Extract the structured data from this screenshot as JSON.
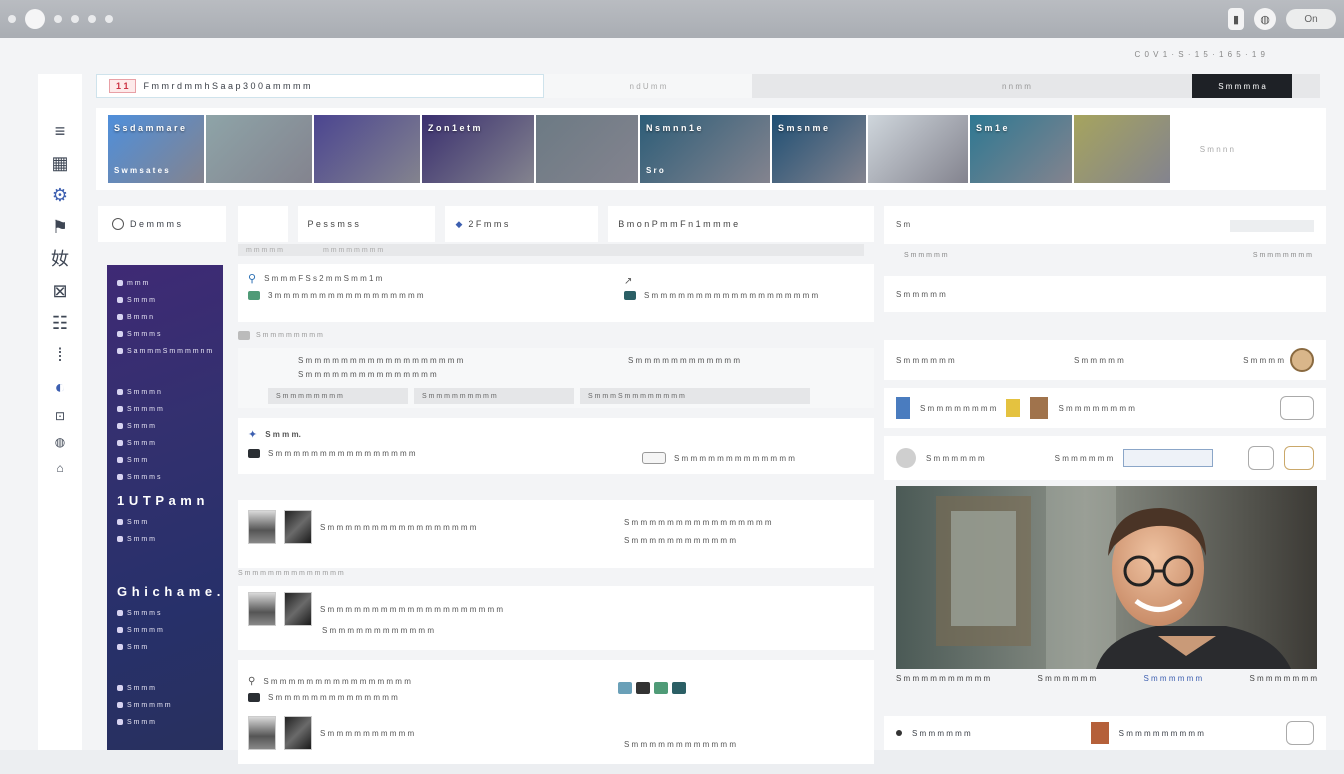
{
  "window": {
    "title": "",
    "right_pill": "On"
  },
  "topline": "C 0 V 1 · S · 1 5 · 1 6 5 · 1 9",
  "rail": {
    "items": [
      "≡",
      "▦",
      "⚙",
      "⚑",
      "奻",
      "⊠",
      "☷",
      "⁞",
      "◐",
      "⊡",
      "◍",
      "⌂"
    ]
  },
  "notification": {
    "badge": "1 1",
    "text": "F m m r d  m m h  S a a p  3 0 0 a m m m m",
    "middle": "n d U m m",
    "right": "n n m m",
    "button": "S m m m m a"
  },
  "banner": {
    "tiles": [
      {
        "label": "S s d a m m a r e",
        "sub": "S w m s  a t e s",
        "color": "#4f8fdb"
      },
      {
        "label": "",
        "sub": "",
        "color": "#8ea4a8"
      },
      {
        "label": "",
        "sub": "",
        "color": "#4b4590"
      },
      {
        "label": "Z o n 1 e t m",
        "sub": "",
        "color": "#3a2f6f"
      },
      {
        "label": "",
        "sub": "",
        "color": "#6c7a84"
      },
      {
        "label": "N s m n n 1 e",
        "sub": "S r o",
        "color": "#2d5d78"
      },
      {
        "label": "S m s n m e",
        "sub": "",
        "color": "#1f4f74"
      },
      {
        "label": "",
        "sub": "",
        "color": "#cfd6dc"
      },
      {
        "label": "S m 1 e",
        "sub": "",
        "color": "#2e7892"
      },
      {
        "label": "",
        "sub": "",
        "color": "#a6a45e"
      }
    ],
    "more": "S m n n n"
  },
  "search": {
    "placeholder": "D e m m m s"
  },
  "filters": {
    "f1": "P e s s m s s",
    "f2": "2 F m m s",
    "f3": "B m o n  P m m  F n  1 m m m e",
    "sub1": "m m m m m",
    "sub2": "m m m m m m m m"
  },
  "sidenav": {
    "items_a": [
      "m m m",
      "S m m m",
      "B m m n",
      "S m m m s",
      "S a m m m  S m m m m  n m m"
    ],
    "items_b": [
      "S m m m n",
      "S m m m m",
      "S m m m",
      "S m m m",
      "S m m",
      "S m m m s"
    ],
    "head1": "1 U T P a m n",
    "items_c": [
      "S m m",
      "S m m m"
    ],
    "head2": "G h i c h a m e .",
    "items_d": [
      "S m m m s",
      "S m m m m",
      "S m m"
    ],
    "items_e": [
      "S m m m",
      "S m m m m m",
      "S m m m"
    ]
  },
  "feed": {
    "c1_title": "S m m m  F S s 2 m m  S m m 1 m",
    "c1_sub": "3 m m m m m m  m m m m m m m m m m m",
    "c1_tag": "S m m m m m m m m",
    "c1_right": "S m m m m m m m m m m m m m m m m m m m",
    "c2_line1": "S m m m m m m m m m m m m m m m m m m",
    "c2_line2": "S m m m m m m m m m m m m m m m",
    "c2_bar1": "S m m m m m  m m m",
    "c2_bar2": "S m m m m m m m m m",
    "c2_bar3": "S m m m  S m m m m m m m m",
    "c3_title": "S m m m.",
    "c3_sub": "S m m m m m m m m m m m m m m m m",
    "c3_right": "S m m m m m m  m m m m m m m",
    "c4_title": "S m m m m m m m m m m m m m m m m m",
    "c4_meta": "S m m m m m m m m m m m m m",
    "c4_right1": "S m m m m m m m m m m m m m m m m",
    "c4_right2": "S m m m m m m m m m m m m",
    "c5_title": "S m m m m m m m m m m m m m m m m m m m m",
    "c5_sub": "S m m m m m m m m m m m m",
    "c6_title": "S m m m m m m m m m m m m m m m m",
    "c6_sub": "S m m m m m m m m m m m m m m",
    "c7_title": "S m m m m m m m m m m",
    "c7_sub": "S m m m m m m m m m m m m"
  },
  "right": {
    "r1_left": "S m",
    "r1_sub_l": "S m m m m m",
    "r1_sub_r": "S m m m m m m m",
    "r2": "S m m m m m",
    "r3_left": "S m m m m m m",
    "r3_mid": "S m m m m m",
    "r3_right": "S m m m m",
    "r4_left": "S m m m m m m m m",
    "r4_mid": "S m m m m m m m m",
    "r5_left": "S m m m m m m",
    "r5_mid": "S m m m m m m",
    "caption_a": "S m m m m m m m m m m",
    "caption_b": "S m m m m m m",
    "caption_c": "S m m m m m m",
    "caption_d": "S m m m m m m m",
    "bottom_l": "S m m m m m m",
    "bottom_r": "S m m m m m m m m m"
  }
}
